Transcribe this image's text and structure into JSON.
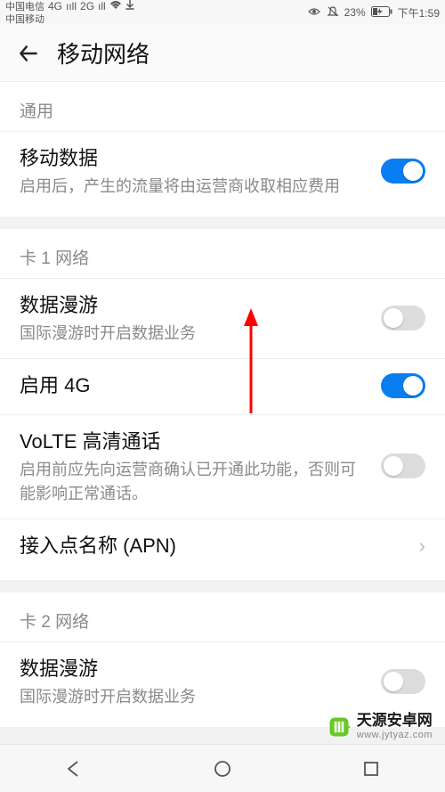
{
  "status": {
    "carrier1": "中国电信",
    "carrier2": "中国移动",
    "net1": "4G",
    "net2": "2G",
    "battery_pct": "23%",
    "time": "下午1:59"
  },
  "header": {
    "title": "移动网络"
  },
  "sections": [
    {
      "header": "通用",
      "rows": [
        {
          "title": "移动数据",
          "sub": "启用后，产生的流量将由运营商收取相应费用",
          "toggle": true
        }
      ]
    },
    {
      "header": "卡 1 网络",
      "rows": [
        {
          "title": "数据漫游",
          "sub": "国际漫游时开启数据业务",
          "toggle": false
        },
        {
          "title": "启用 4G",
          "sub": "",
          "toggle": true
        },
        {
          "title": "VoLTE 高清通话",
          "sub": "启用前应先向运营商确认已开通此功能，否则可能影响正常通话。",
          "toggle": false
        },
        {
          "title": "接入点名称 (APN)",
          "sub": "",
          "nav": true
        }
      ]
    },
    {
      "header": "卡 2 网络",
      "rows": [
        {
          "title": "数据漫游",
          "sub": "国际漫游时开启数据业务",
          "toggle": false
        }
      ]
    }
  ],
  "watermark": {
    "main": "天源安卓网",
    "sub": "www.jytyaz.com"
  },
  "colors": {
    "accent": "#0a7ef0",
    "annotation": "#ff0000"
  }
}
